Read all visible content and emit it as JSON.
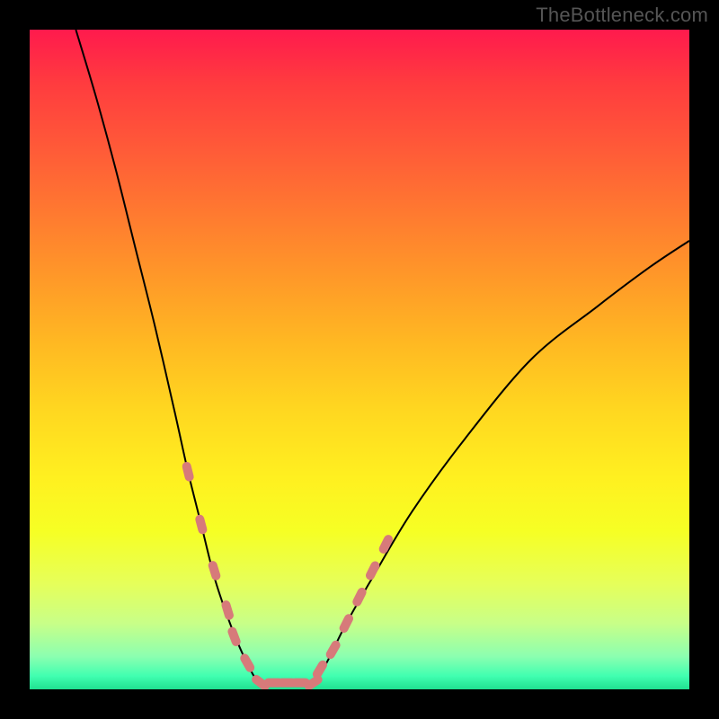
{
  "watermark": "TheBottleneck.com",
  "colors": {
    "frame_bg": "#000000",
    "watermark": "#555555",
    "curve": "#000000",
    "marker": "#d77a7a",
    "gradient_stops": [
      "#ff1a4d",
      "#ff3b3f",
      "#ff5a38",
      "#ff7a30",
      "#ff9a28",
      "#ffba22",
      "#ffd820",
      "#fff020",
      "#f6ff24",
      "#e6ff5a",
      "#c8ff88",
      "#8cffb0",
      "#40ffb0",
      "#20e090"
    ]
  },
  "chart_data": {
    "type": "line",
    "title": "",
    "xlabel": "",
    "ylabel": "",
    "xlim": [
      0,
      100
    ],
    "ylim": [
      0,
      100
    ],
    "grid": false,
    "series": [
      {
        "name": "curve-left",
        "x": [
          7,
          10,
          13,
          16,
          19,
          22,
          24,
          26,
          28,
          30,
          32,
          34,
          35
        ],
        "y": [
          100,
          90,
          79,
          67,
          55,
          42,
          33,
          25,
          17,
          11,
          6,
          2,
          1
        ]
      },
      {
        "name": "curve-bottom",
        "x": [
          35,
          37,
          39,
          41,
          43
        ],
        "y": [
          1,
          1,
          1,
          1,
          1
        ]
      },
      {
        "name": "curve-right",
        "x": [
          43,
          45,
          48,
          52,
          58,
          66,
          76,
          86,
          94,
          100
        ],
        "y": [
          1,
          4,
          10,
          17,
          27,
          38,
          50,
          58,
          64,
          68
        ]
      }
    ],
    "markers": {
      "name": "highlight-points",
      "x": [
        24,
        26,
        28,
        30,
        31,
        33,
        35,
        37,
        39,
        41,
        43,
        44,
        46,
        48,
        50,
        52,
        54
      ],
      "y": [
        33,
        25,
        18,
        12,
        8,
        4,
        1,
        1,
        1,
        1,
        1,
        3,
        6,
        10,
        14,
        18,
        22
      ]
    }
  }
}
